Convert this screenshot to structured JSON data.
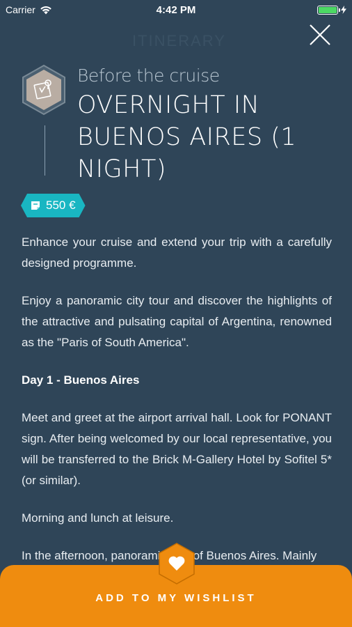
{
  "status_bar": {
    "carrier": "Carrier",
    "time": "4:42 PM"
  },
  "background_ghost": "ITINERARY",
  "header": {
    "subtitle": "Before the cruise",
    "title": "OVERNIGHT IN BUENOS AIRES (1 NIGHT)"
  },
  "price": {
    "label": "550 €",
    "color": "#19b6c2"
  },
  "content": {
    "paragraphs": [
      "Enhance your cruise and extend your trip with a carefully designed programme.",
      "Enjoy a panoramic city tour and discover the highlights of the attractive and pulsating capital of Argentina, renowned as the \"Paris of South America\".",
      "Day 1 - Buenos Aires",
      "Meet and greet at the airport arrival hall. Look for PONANT sign. After being welcomed by our local representative, you will be transferred to the Brick M-Gallery Hotel by Sofitel 5* (or similar).",
      "Morning and lunch at leisure.",
      "In the afternoon, panoramic tour of Buenos Aires. Mainly"
    ]
  },
  "wishlist": {
    "label": "ADD TO MY WISHLIST",
    "color": "#ef8c0f"
  },
  "colors": {
    "background": "#2f4558",
    "accent_orange": "#ef8c0f",
    "accent_teal": "#19b6c2"
  },
  "icons": {
    "header": "map-hex-icon",
    "close": "close-icon",
    "wishlist": "heart-icon",
    "price": "ticket-icon"
  }
}
